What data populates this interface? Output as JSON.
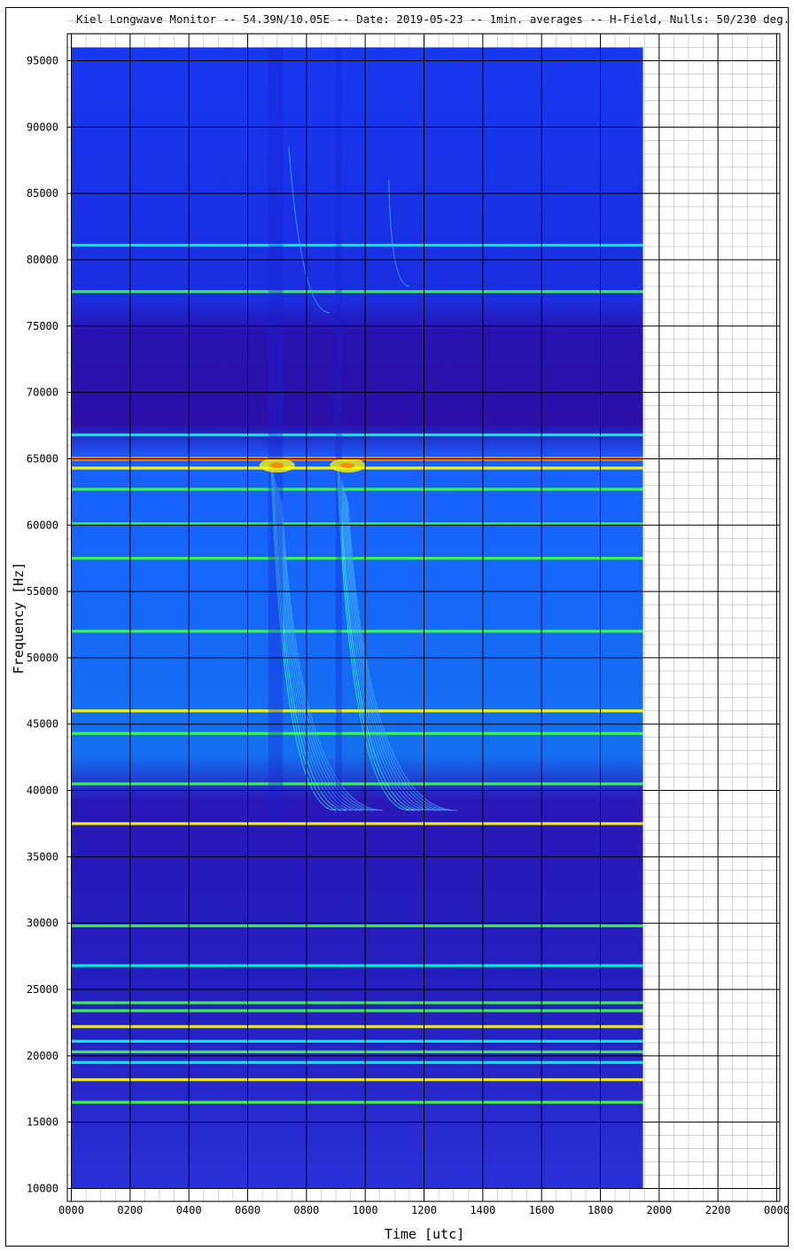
{
  "chart_data": {
    "type": "heatmap",
    "title": "Kiel Longwave Monitor -- 54.39N/10.05E -- Date: 2019-05-23 -- 1min. averages -- H-Field, Nulls: 50/230 deg.",
    "xlabel": "Time [utc]",
    "ylabel": "Frequency [Hz]",
    "xlim": [
      0,
      2400
    ],
    "ylim": [
      9000,
      98000
    ],
    "x_ticks": [
      "0000",
      "0200",
      "0400",
      "0600",
      "0800",
      "1000",
      "1200",
      "1400",
      "1600",
      "1800",
      "2000",
      "2200",
      "0000"
    ],
    "y_ticks": [
      "10000",
      "15000",
      "20000",
      "25000",
      "30000",
      "35000",
      "40000",
      "45000",
      "50000",
      "55000",
      "60000",
      "65000",
      "70000",
      "75000",
      "80000",
      "85000",
      "90000",
      "95000"
    ],
    "data_extent": {
      "time_start": "0000",
      "time_end": "1945",
      "freq_min": 10000,
      "freq_max": 96000
    },
    "grid": true,
    "colormap": [
      "#2a00a0",
      "#0030ff",
      "#00a0ff",
      "#00ffd0",
      "#40ff40",
      "#ffff00",
      "#ff8000"
    ],
    "bands": [
      {
        "f": 81100,
        "level": 0.55
      },
      {
        "f": 77600,
        "level": 0.7
      },
      {
        "f": 66800,
        "level": 0.5
      },
      {
        "f": 65000,
        "level": 0.95
      },
      {
        "f": 64300,
        "level": 0.85
      },
      {
        "f": 62700,
        "level": 0.6
      },
      {
        "f": 60100,
        "level": 0.65
      },
      {
        "f": 57500,
        "level": 0.7
      },
      {
        "f": 52000,
        "level": 0.72
      },
      {
        "f": 46000,
        "level": 0.78
      },
      {
        "f": 44300,
        "level": 0.6
      },
      {
        "f": 40500,
        "level": 0.72
      },
      {
        "f": 37500,
        "level": 0.8
      },
      {
        "f": 29800,
        "level": 0.6
      },
      {
        "f": 26800,
        "level": 0.58
      },
      {
        "f": 24000,
        "level": 0.6
      },
      {
        "f": 23400,
        "level": 0.65
      },
      {
        "f": 22200,
        "level": 0.75
      },
      {
        "f": 21100,
        "level": 0.55
      },
      {
        "f": 20300,
        "level": 0.62
      },
      {
        "f": 19500,
        "level": 0.55
      },
      {
        "f": 18200,
        "level": 0.82
      },
      {
        "f": 16500,
        "level": 0.6
      }
    ]
  }
}
